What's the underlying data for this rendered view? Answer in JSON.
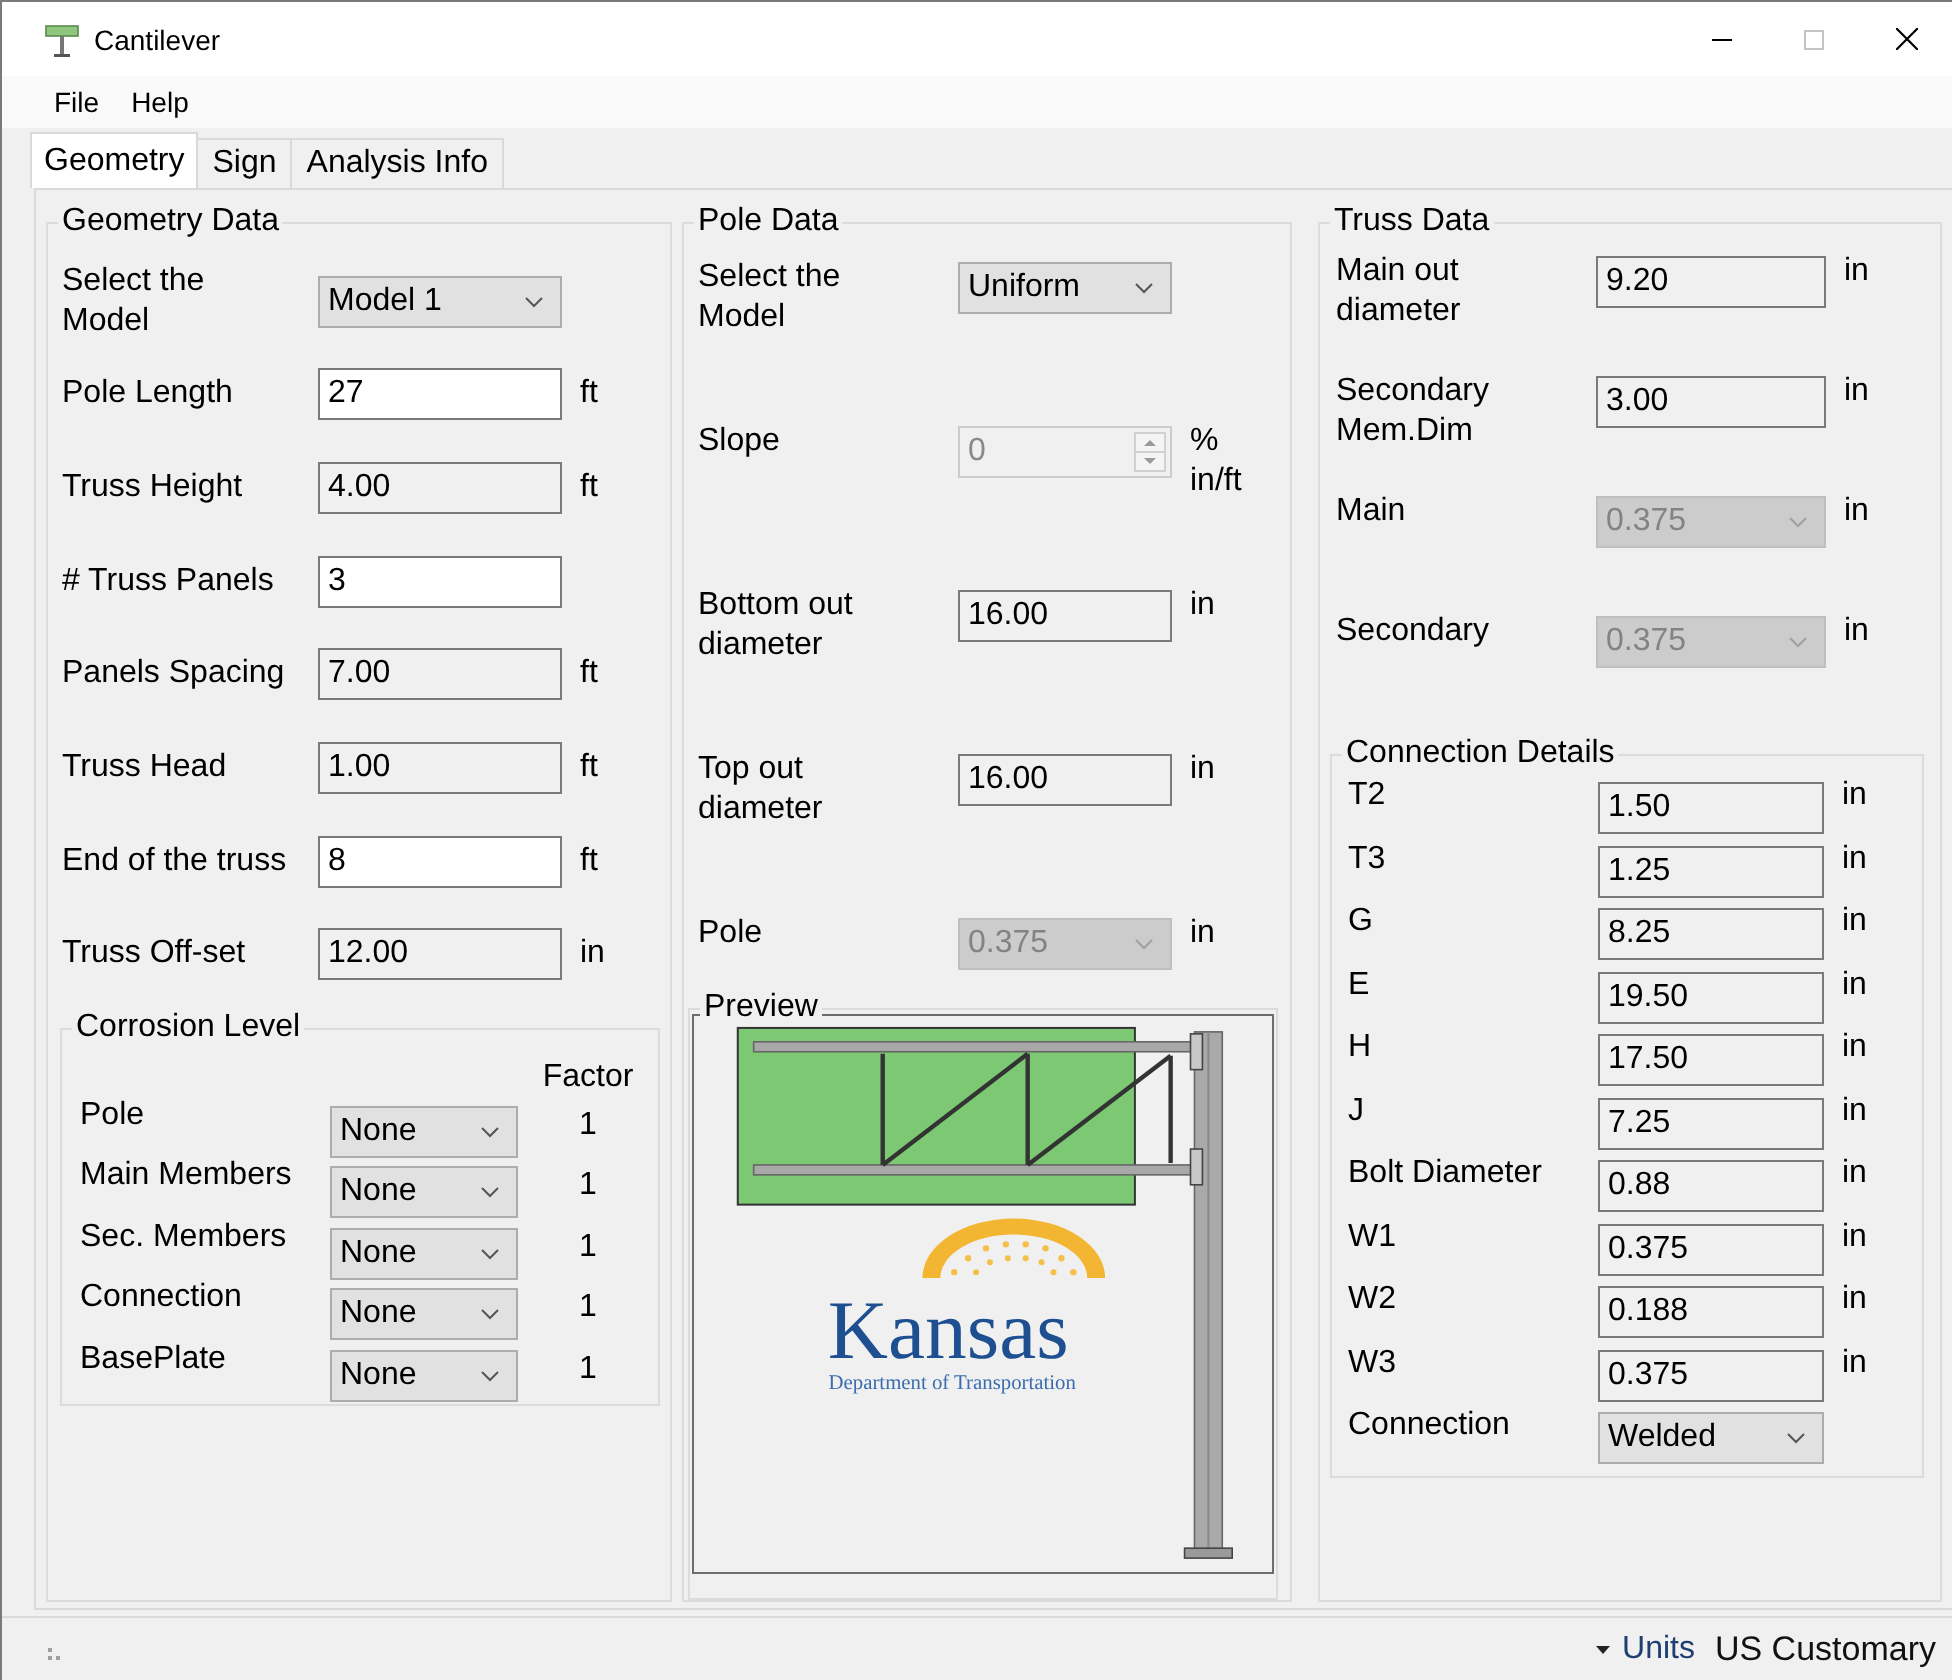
{
  "window": {
    "title": "Cantilever",
    "maximize_enabled": false
  },
  "menu": [
    "File",
    "Help"
  ],
  "tabs": [
    {
      "label": "Geometry",
      "selected": true
    },
    {
      "label": "Sign",
      "selected": false
    },
    {
      "label": "Analysis Info",
      "selected": false
    }
  ],
  "geometry_data": {
    "title": "Geometry Data",
    "fields": [
      {
        "label": "Select the\nModel",
        "kind": "combo",
        "value": "Model 1",
        "disabled": false
      },
      {
        "label": "Pole Length",
        "kind": "text",
        "value": "27",
        "readonly": false,
        "unit": "ft"
      },
      {
        "label": "Truss Height",
        "kind": "text",
        "value": "4.00",
        "readonly": true,
        "unit": "ft"
      },
      {
        "label": "# Truss Panels",
        "kind": "text",
        "value": "3",
        "readonly": false
      },
      {
        "label": "Panels Spacing",
        "kind": "text",
        "value": "7.00",
        "readonly": true,
        "unit": "ft"
      },
      {
        "label": "Truss Head",
        "kind": "text",
        "value": "1.00",
        "readonly": true,
        "unit": "ft"
      },
      {
        "label": "End of the truss",
        "kind": "text",
        "value": "8",
        "readonly": false,
        "unit": "ft"
      },
      {
        "label": "Truss Off-set",
        "kind": "text",
        "value": "12.00",
        "readonly": true,
        "unit": "in"
      }
    ]
  },
  "corrosion_level": {
    "title": "Corrosion Level",
    "factor_header": "Factor",
    "rows": [
      {
        "label": "Pole",
        "value": "None",
        "factor": "1"
      },
      {
        "label": "Main Members",
        "value": "None",
        "factor": "1"
      },
      {
        "label": "Sec. Members",
        "value": "None",
        "factor": "1"
      },
      {
        "label": "Connection",
        "value": "None",
        "factor": "1"
      },
      {
        "label": "BasePlate",
        "value": "None",
        "factor": "1"
      }
    ]
  },
  "pole_data": {
    "title": "Pole Data",
    "fields": [
      {
        "label": "Select the\nModel",
        "kind": "combo",
        "value": "Uniform",
        "disabled": false
      },
      {
        "label": "Slope",
        "kind": "spin",
        "value": "0",
        "disabled": true,
        "unit": "%\nin/ft"
      },
      {
        "label": "Bottom out\ndiameter",
        "kind": "text",
        "value": "16.00",
        "readonly": true,
        "unit": "in"
      },
      {
        "label": "Top out\ndiameter",
        "kind": "text",
        "value": "16.00",
        "readonly": true,
        "unit": "in"
      },
      {
        "label": "Pole",
        "kind": "combo",
        "value": "0.375",
        "disabled": true,
        "unit": "in"
      }
    ]
  },
  "preview": {
    "title": "Preview",
    "logo_name": "Kansas",
    "logo_subtitle": "Department of Transportation"
  },
  "truss_data": {
    "title": "Truss Data",
    "fields": [
      {
        "label": "Main out\ndiameter",
        "kind": "text",
        "value": "9.20",
        "readonly": true,
        "unit": "in"
      },
      {
        "label": "Secondary\nMem.Dim",
        "kind": "text",
        "value": "3.00",
        "readonly": true,
        "unit": "in"
      },
      {
        "label": "Main",
        "kind": "combo",
        "value": "0.375",
        "disabled": true,
        "unit": "in"
      },
      {
        "label": "Secondary",
        "kind": "combo",
        "value": "0.375",
        "disabled": true,
        "unit": "in"
      }
    ]
  },
  "connection_details": {
    "title": "Connection Details",
    "fields": [
      {
        "label": "T2",
        "kind": "text",
        "value": "1.50",
        "readonly": true,
        "unit": "in"
      },
      {
        "label": "T3",
        "kind": "text",
        "value": "1.25",
        "readonly": true,
        "unit": "in"
      },
      {
        "label": "G",
        "kind": "text",
        "value": "8.25",
        "readonly": true,
        "unit": "in"
      },
      {
        "label": "E",
        "kind": "text",
        "value": "19.50",
        "readonly": true,
        "unit": "in"
      },
      {
        "label": "H",
        "kind": "text",
        "value": "17.50",
        "readonly": true,
        "unit": "in"
      },
      {
        "label": "J",
        "kind": "text",
        "value": "7.25",
        "readonly": true,
        "unit": "in"
      },
      {
        "label": "Bolt Diameter",
        "kind": "text",
        "value": "0.88",
        "readonly": true,
        "unit": "in"
      },
      {
        "label": "W1",
        "kind": "text",
        "value": "0.375",
        "readonly": true,
        "unit": "in"
      },
      {
        "label": "W2",
        "kind": "text",
        "value": "0.188",
        "readonly": true,
        "unit": "in"
      },
      {
        "label": "W3",
        "kind": "text",
        "value": "0.375",
        "readonly": true,
        "unit": "in"
      },
      {
        "label": "Connection",
        "kind": "combo",
        "value": "Welded",
        "disabled": false
      }
    ]
  },
  "status_bar": {
    "label": "Units",
    "value": "US Customary"
  }
}
